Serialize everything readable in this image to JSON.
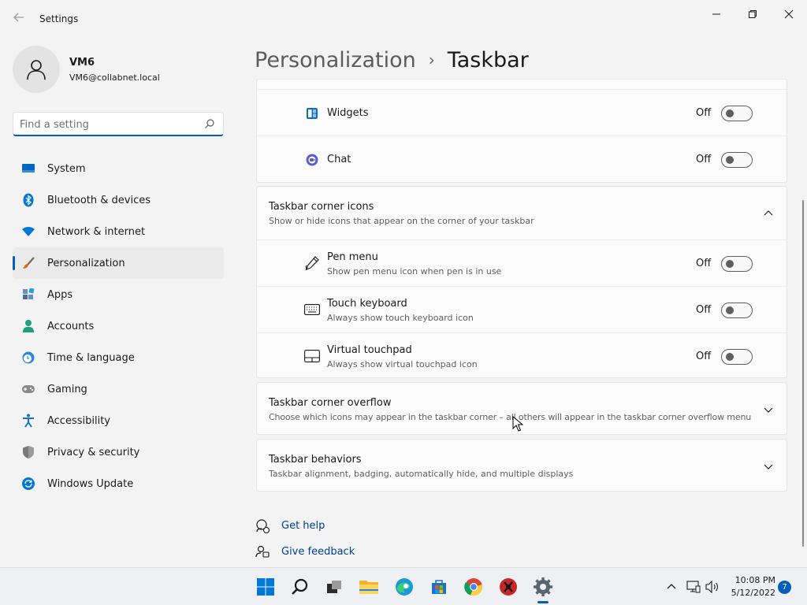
{
  "window": {
    "title": "Settings",
    "back_icon": "back-arrow-icon",
    "controls": [
      "minimize-icon",
      "maximize-icon",
      "close-icon"
    ]
  },
  "user": {
    "name": "VM6",
    "email": "VM6@collabnet.local",
    "avatar_icon": "person-icon"
  },
  "search": {
    "placeholder": "Find a setting",
    "value": "",
    "icon": "search-icon"
  },
  "nav": {
    "active": "Personalization",
    "items": [
      {
        "label": "System",
        "icon": "system-icon"
      },
      {
        "label": "Bluetooth & devices",
        "icon": "bluetooth-icon"
      },
      {
        "label": "Network & internet",
        "icon": "wifi-icon"
      },
      {
        "label": "Personalization",
        "icon": "brush-icon"
      },
      {
        "label": "Apps",
        "icon": "apps-icon"
      },
      {
        "label": "Accounts",
        "icon": "accounts-icon"
      },
      {
        "label": "Time & language",
        "icon": "clock-globe-icon"
      },
      {
        "label": "Gaming",
        "icon": "gamepad-icon"
      },
      {
        "label": "Accessibility",
        "icon": "accessibility-icon"
      },
      {
        "label": "Privacy & security",
        "icon": "shield-icon"
      },
      {
        "label": "Windows Update",
        "icon": "update-icon"
      }
    ]
  },
  "header": {
    "parent": "Personalization",
    "separator": "›",
    "current": "Taskbar"
  },
  "taskbar_items": {
    "items": [
      {
        "label": "Widgets",
        "state": "Off",
        "icon": "widgets-icon"
      },
      {
        "label": "Chat",
        "state": "Off",
        "icon": "chat-icon"
      }
    ]
  },
  "corner_icons": {
    "title": "Taskbar corner icons",
    "subtitle": "Show or hide icons that appear on the corner of your taskbar",
    "expanded": true,
    "items": [
      {
        "label": "Pen menu",
        "description": "Show pen menu icon when pen is in use",
        "state": "Off",
        "icon": "pen-icon"
      },
      {
        "label": "Touch keyboard",
        "description": "Always show touch keyboard icon",
        "state": "Off",
        "icon": "keyboard-icon"
      },
      {
        "label": "Virtual touchpad",
        "description": "Always show virtual touchpad icon",
        "state": "Off",
        "icon": "touchpad-icon"
      }
    ]
  },
  "corner_overflow": {
    "title": "Taskbar corner overflow",
    "subtitle": "Choose which icons may appear in the taskbar corner – all others will appear in the taskbar corner overflow menu",
    "expanded": false
  },
  "behaviors": {
    "title": "Taskbar behaviors",
    "subtitle": "Taskbar alignment, badging, automatically hide, and multiple displays",
    "expanded": false
  },
  "links": {
    "help": "Get help",
    "feedback": "Give feedback"
  },
  "os_taskbar": {
    "apps": [
      "start-icon",
      "search-icon",
      "task-view-icon",
      "file-explorer-icon",
      "edge-icon",
      "store-icon",
      "chrome-icon",
      "game-app-icon",
      "settings-icon"
    ],
    "active_app": "settings-icon",
    "tray": [
      "chevron-up-icon",
      "network-icon",
      "volume-icon"
    ],
    "time": "10:08 PM",
    "date": "5/12/2022",
    "notification_count": "7"
  },
  "colors": {
    "accent": "#005fb8",
    "link": "#003e92",
    "background": "#f3f3f3",
    "card": "#fbfbfb"
  }
}
